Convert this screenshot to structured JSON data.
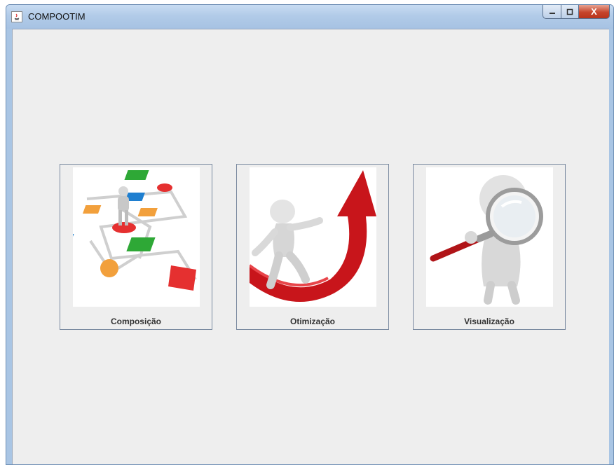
{
  "window": {
    "title": "COMPOOTIM",
    "controls": {
      "minimize_icon": "minimize-icon",
      "maximize_icon": "maximize-icon",
      "close_label": "X"
    }
  },
  "cards": [
    {
      "label": "Composição",
      "icon": "composition-flowchart-illustration"
    },
    {
      "label": "Otimização",
      "icon": "optimization-arrow-illustration"
    },
    {
      "label": "Visualização",
      "icon": "magnifier-illustration"
    }
  ],
  "colors": {
    "window_bg": "#eeeeee",
    "titlebar": "#b2cbe8",
    "close_button": "#c6452c",
    "card_border": "#7a8aa0"
  }
}
